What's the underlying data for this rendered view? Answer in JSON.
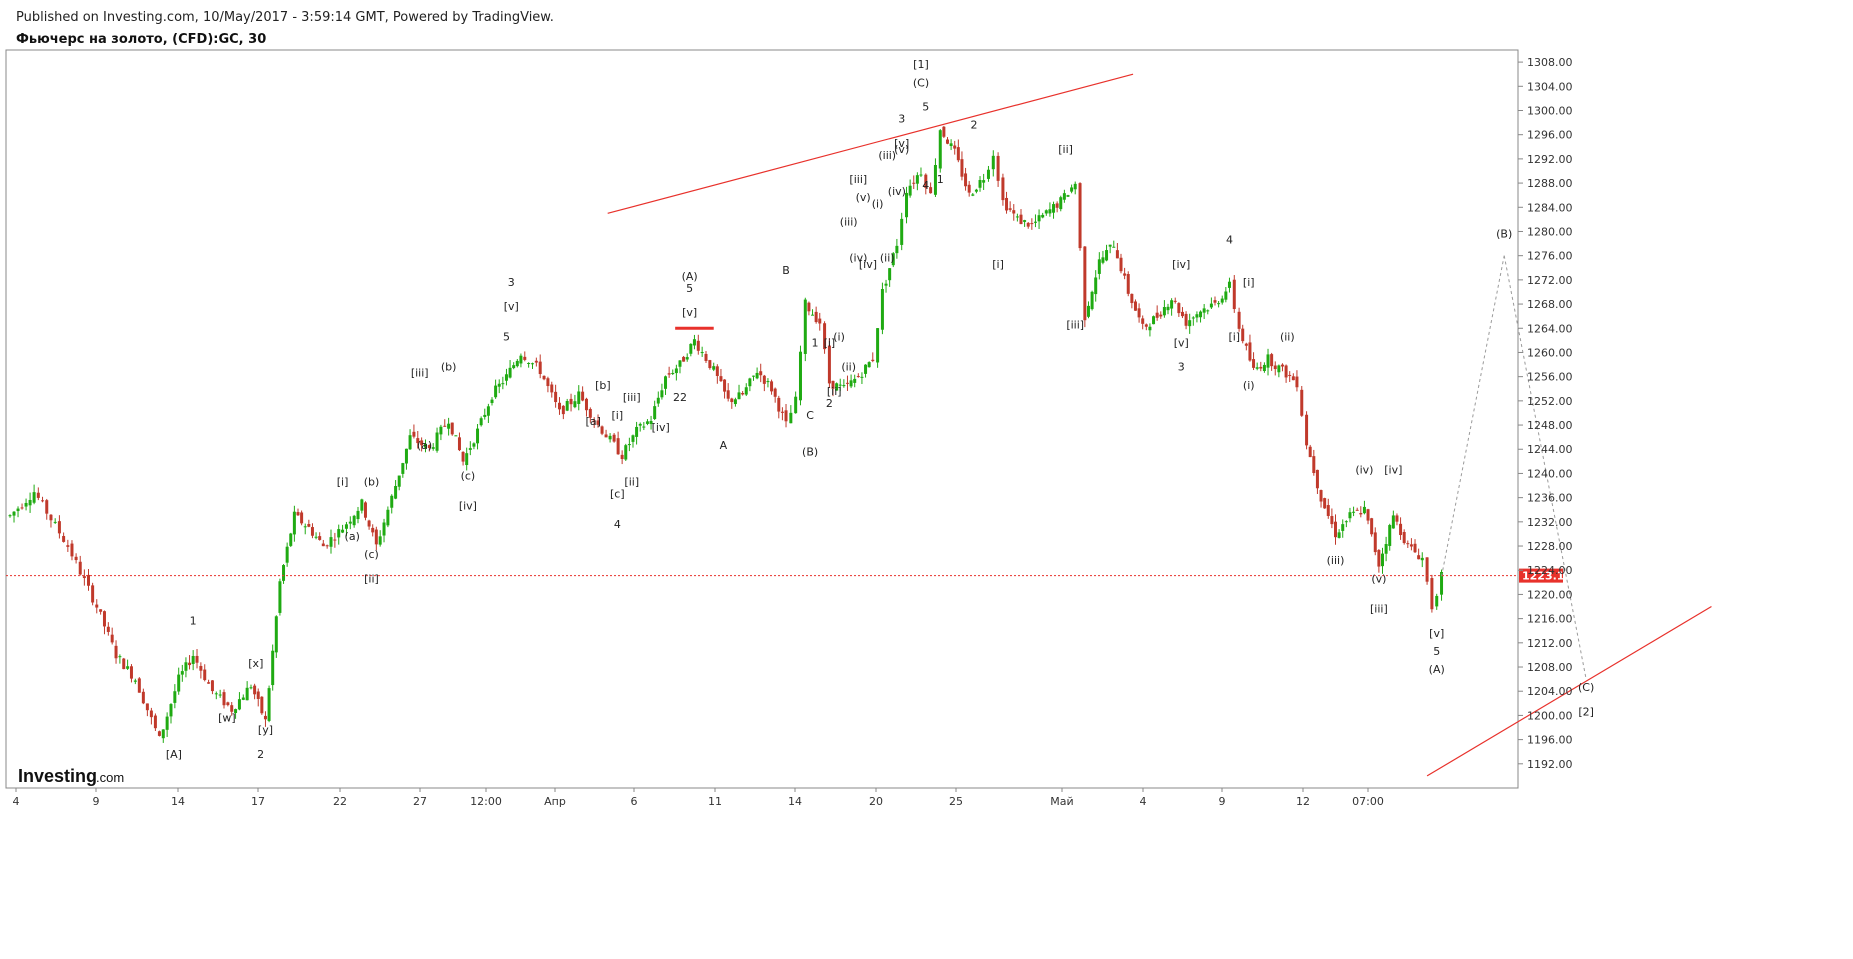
{
  "header": {
    "published": "Published on Investing.com, 10/May/2017 - 3:59:14 GMT, Powered by TradingView.",
    "symbol": "Фьючерс на золото, (CFD):GC, 30"
  },
  "colors": {
    "up": "#1faa12",
    "down": "#c0392b",
    "trendline": "#e8312b",
    "current_price": "#e8312b",
    "projection": "#9a9a9a"
  },
  "chart_data": {
    "type": "candlestick",
    "title": "Фьючерс на золото, (CFD):GC, 30",
    "ylim": [
      1188,
      1310
    ],
    "y_ticks": [
      "1308.00",
      "1304.00",
      "1300.00",
      "1296.00",
      "1292.00",
      "1288.00",
      "1284.00",
      "1280.00",
      "1276.00",
      "1272.00",
      "1268.00",
      "1264.00",
      "1260.00",
      "1256.00",
      "1252.00",
      "1248.00",
      "1244.00",
      "1240.00",
      "1236.00",
      "1232.00",
      "1228.00",
      "1224.00",
      "1220.00",
      "1216.00",
      "1212.00",
      "1208.00",
      "1204.00",
      "1200.00",
      "1196.00",
      "1192.00"
    ],
    "x_ticks": [
      "4",
      "9",
      "14",
      "17",
      "22",
      "27",
      "12:00",
      "Апр",
      "6",
      "11",
      "14",
      "20",
      "25",
      "Май",
      "4",
      "9",
      "12",
      "07:00"
    ],
    "current_price": "1223.11",
    "price_path": [
      [
        0,
        1233
      ],
      [
        5,
        1237
      ],
      [
        12,
        1228
      ],
      [
        18,
        1218
      ],
      [
        22,
        1210
      ],
      [
        26,
        1206
      ],
      [
        31,
        1196
      ],
      [
        35,
        1206
      ],
      [
        38,
        1210
      ],
      [
        42,
        1204
      ],
      [
        46,
        1201
      ],
      [
        50,
        1205
      ],
      [
        53,
        1199
      ],
      [
        56,
        1222
      ],
      [
        59,
        1233
      ],
      [
        62,
        1231
      ],
      [
        65,
        1228
      ],
      [
        69,
        1231
      ],
      [
        73,
        1235
      ],
      [
        76,
        1228
      ],
      [
        80,
        1238
      ],
      [
        83,
        1246
      ],
      [
        87,
        1244
      ],
      [
        91,
        1249
      ],
      [
        94,
        1242
      ],
      [
        97,
        1247
      ],
      [
        100,
        1253
      ],
      [
        103,
        1256
      ],
      [
        106,
        1260
      ],
      [
        110,
        1257
      ],
      [
        114,
        1250
      ],
      [
        118,
        1253
      ],
      [
        122,
        1248
      ],
      [
        127,
        1243
      ],
      [
        130,
        1247
      ],
      [
        133,
        1249
      ],
      [
        136,
        1256
      ],
      [
        139,
        1258
      ],
      [
        142,
        1262
      ],
      [
        146,
        1257
      ],
      [
        149,
        1252
      ],
      [
        152,
        1253
      ],
      [
        155,
        1257
      ],
      [
        158,
        1254
      ],
      [
        161,
        1248
      ],
      [
        163,
        1252
      ],
      [
        165,
        1268
      ],
      [
        168,
        1265
      ],
      [
        170,
        1255
      ],
      [
        173,
        1254
      ],
      [
        176,
        1256
      ],
      [
        179,
        1259
      ],
      [
        181,
        1270
      ],
      [
        184,
        1278
      ],
      [
        186,
        1287
      ],
      [
        189,
        1290
      ],
      [
        191,
        1286
      ],
      [
        193,
        1297
      ],
      [
        196,
        1293
      ],
      [
        199,
        1286
      ],
      [
        202,
        1289
      ],
      [
        204,
        1293
      ],
      [
        206,
        1285
      ],
      [
        209,
        1282
      ],
      [
        212,
        1281
      ],
      [
        215,
        1283
      ],
      [
        218,
        1285
      ],
      [
        221,
        1288
      ],
      [
        223,
        1266
      ],
      [
        226,
        1275
      ],
      [
        229,
        1278
      ],
      [
        232,
        1270
      ],
      [
        235,
        1264
      ],
      [
        238,
        1266
      ],
      [
        241,
        1269
      ],
      [
        244,
        1265
      ],
      [
        247,
        1267
      ],
      [
        250,
        1268
      ],
      [
        253,
        1271
      ],
      [
        255,
        1264
      ],
      [
        258,
        1257
      ],
      [
        261,
        1259
      ],
      [
        264,
        1257
      ],
      [
        267,
        1255
      ],
      [
        269,
        1245
      ],
      [
        272,
        1236
      ],
      [
        275,
        1230
      ],
      [
        278,
        1233
      ],
      [
        281,
        1234
      ],
      [
        284,
        1225
      ],
      [
        287,
        1233
      ],
      [
        290,
        1228
      ],
      [
        293,
        1226
      ],
      [
        295,
        1218
      ],
      [
        297,
        1223
      ]
    ],
    "projection": [
      [
        297,
        1223
      ],
      [
        310,
        1276
      ],
      [
        327,
        1206
      ]
    ],
    "wave_labels": [
      {
        "t": "1",
        "x": 38,
        "y": 1215
      },
      {
        "t": "[A]",
        "x": 34,
        "y": 1193
      },
      {
        "t": "[w]",
        "x": 45,
        "y": 1199
      },
      {
        "t": "[x]",
        "x": 51,
        "y": 1208
      },
      {
        "t": "[y]",
        "x": 53,
        "y": 1197
      },
      {
        "t": "2",
        "x": 52,
        "y": 1193
      },
      {
        "t": "[i]",
        "x": 69,
        "y": 1238
      },
      {
        "t": "(a)",
        "x": 71,
        "y": 1229
      },
      {
        "t": "(b)",
        "x": 75,
        "y": 1238
      },
      {
        "t": "(c)",
        "x": 75,
        "y": 1226
      },
      {
        "t": "[ii]",
        "x": 75,
        "y": 1222
      },
      {
        "t": "[iii]",
        "x": 85,
        "y": 1256
      },
      {
        "t": "(a)",
        "x": 86,
        "y": 1244
      },
      {
        "t": "(b)",
        "x": 91,
        "y": 1257
      },
      {
        "t": "(c)",
        "x": 95,
        "y": 1239
      },
      {
        "t": "[iv]",
        "x": 95,
        "y": 1234
      },
      {
        "t": "3",
        "x": 104,
        "y": 1271
      },
      {
        "t": "[v]",
        "x": 104,
        "y": 1267
      },
      {
        "t": "5",
        "x": 103,
        "y": 1262
      },
      {
        "t": "[a]",
        "x": 121,
        "y": 1248
      },
      {
        "t": "[b]",
        "x": 123,
        "y": 1254
      },
      {
        "t": "[i]",
        "x": 126,
        "y": 1249
      },
      {
        "t": "[iii]",
        "x": 129,
        "y": 1252
      },
      {
        "t": "[iv]",
        "x": 135,
        "y": 1247
      },
      {
        "t": "[ii]",
        "x": 129,
        "y": 1238
      },
      {
        "t": "[c]",
        "x": 126,
        "y": 1236
      },
      {
        "t": "4",
        "x": 126,
        "y": 1231
      },
      {
        "t": "22",
        "x": 139,
        "y": 1252
      },
      {
        "t": "(A)",
        "x": 141,
        "y": 1272
      },
      {
        "t": "5",
        "x": 141,
        "y": 1270
      },
      {
        "t": "[v]",
        "x": 141,
        "y": 1266
      },
      {
        "t": "A",
        "x": 148,
        "y": 1244
      },
      {
        "t": "B",
        "x": 161,
        "y": 1273
      },
      {
        "t": "C",
        "x": 166,
        "y": 1249
      },
      {
        "t": "(B)",
        "x": 166,
        "y": 1243
      },
      {
        "t": "1",
        "x": 167,
        "y": 1261
      },
      {
        "t": "[i]",
        "x": 170,
        "y": 1261
      },
      {
        "t": "(i)",
        "x": 172,
        "y": 1262
      },
      {
        "t": "(ii)",
        "x": 174,
        "y": 1257
      },
      {
        "t": "[ii]",
        "x": 171,
        "y": 1253
      },
      {
        "t": "2",
        "x": 170,
        "y": 1251
      },
      {
        "t": "(iii)",
        "x": 174,
        "y": 1281
      },
      {
        "t": "(v)",
        "x": 177,
        "y": 1285
      },
      {
        "t": "(i)",
        "x": 180,
        "y": 1284
      },
      {
        "t": "(iv)",
        "x": 176,
        "y": 1275
      },
      {
        "t": "[iv]",
        "x": 178,
        "y": 1274
      },
      {
        "t": "(ii)",
        "x": 182,
        "y": 1275
      },
      {
        "t": "[iii]",
        "x": 176,
        "y": 1288
      },
      {
        "t": "(iii)",
        "x": 182,
        "y": 1292
      },
      {
        "t": "(v)",
        "x": 185,
        "y": 1293
      },
      {
        "t": "[v]",
        "x": 185,
        "y": 1294
      },
      {
        "t": "(iv)",
        "x": 184,
        "y": 1286
      },
      {
        "t": "4",
        "x": 190,
        "y": 1287
      },
      {
        "t": "1",
        "x": 193,
        "y": 1288
      },
      {
        "t": "3",
        "x": 185,
        "y": 1298
      },
      {
        "t": "5",
        "x": 190,
        "y": 1300
      },
      {
        "t": "(C)",
        "x": 189,
        "y": 1304
      },
      {
        "t": "[1]",
        "x": 189,
        "y": 1307
      },
      {
        "t": "2",
        "x": 200,
        "y": 1297
      },
      {
        "t": "[ii]",
        "x": 219,
        "y": 1293
      },
      {
        "t": "[i]",
        "x": 205,
        "y": 1274
      },
      {
        "t": "[iii]",
        "x": 221,
        "y": 1264
      },
      {
        "t": "[iv]",
        "x": 243,
        "y": 1274
      },
      {
        "t": "[v]",
        "x": 243,
        "y": 1261
      },
      {
        "t": "3",
        "x": 243,
        "y": 1257
      },
      {
        "t": "4",
        "x": 253,
        "y": 1278
      },
      {
        "t": "[i]",
        "x": 257,
        "y": 1271
      },
      {
        "t": "[i]",
        "x": 254,
        "y": 1262
      },
      {
        "t": "(ii)",
        "x": 265,
        "y": 1262
      },
      {
        "t": "(i)",
        "x": 257,
        "y": 1254
      },
      {
        "t": "(iv)",
        "x": 281,
        "y": 1240
      },
      {
        "t": "[iv]",
        "x": 287,
        "y": 1240
      },
      {
        "t": "(iii)",
        "x": 275,
        "y": 1225
      },
      {
        "t": "(v)",
        "x": 284,
        "y": 1222
      },
      {
        "t": "[iii]",
        "x": 284,
        "y": 1217
      },
      {
        "t": "[v]",
        "x": 296,
        "y": 1213
      },
      {
        "t": "5",
        "x": 296,
        "y": 1210
      },
      {
        "t": "(A)",
        "x": 296,
        "y": 1207
      },
      {
        "t": "(B)",
        "x": 310,
        "y": 1279
      },
      {
        "t": "(C)",
        "x": 327,
        "y": 1204
      },
      {
        "t": "[2]",
        "x": 327,
        "y": 1200
      }
    ],
    "trendlines": [
      [
        [
          124,
          1283
        ],
        [
          233,
          1306
        ]
      ],
      [
        [
          294,
          1190
        ],
        [
          353,
          1218
        ]
      ],
      [
        [
          138,
          1264
        ],
        [
          146,
          1264
        ]
      ]
    ]
  }
}
